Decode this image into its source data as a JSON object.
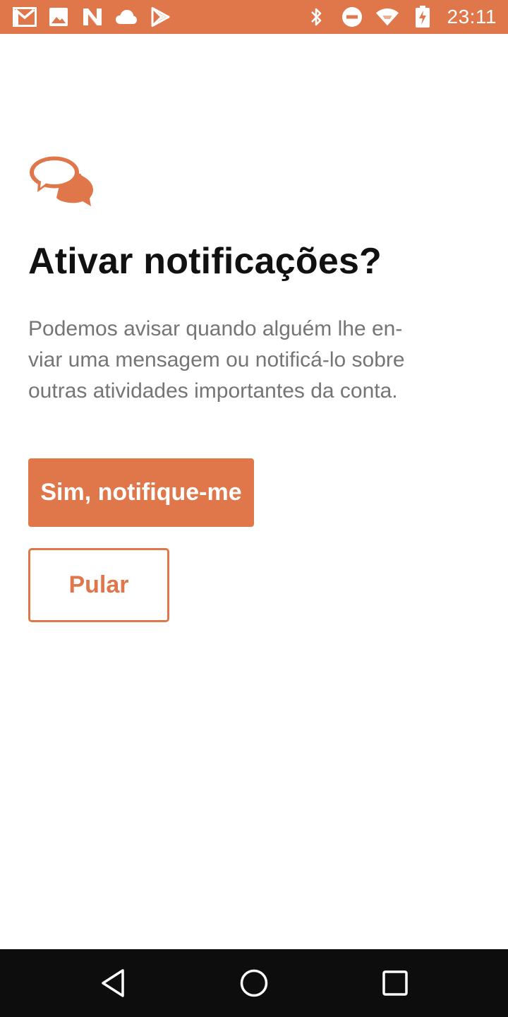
{
  "status_bar": {
    "time": "23:11",
    "left_icons": [
      "gmail-icon",
      "image-icon",
      "n-app-icon",
      "cloud-icon",
      "play-store-icon"
    ],
    "right_icons": [
      "bluetooth-icon",
      "do-not-disturb-icon",
      "wifi-icon",
      "battery-charging-icon"
    ],
    "color": "#e0774b"
  },
  "screen": {
    "icon": "chat-bubbles-icon",
    "title": "Ativar notificações?",
    "description": "Podemos avisar quando alguém lhe en-viar uma mensagem ou notificá-lo sobre outras atividades importantes da conta.",
    "description_lines": [
      "Podemos avisar quando alguém lhe en-",
      "viar uma mensagem ou notificá-lo sobre",
      "outras atividades importantes da conta."
    ],
    "primary_button": "Sim, notifique-me",
    "secondary_button": "Pular",
    "accent_color": "#e0774b"
  },
  "nav_bar": {
    "buttons": [
      "back-icon",
      "home-icon",
      "recents-icon"
    ]
  }
}
